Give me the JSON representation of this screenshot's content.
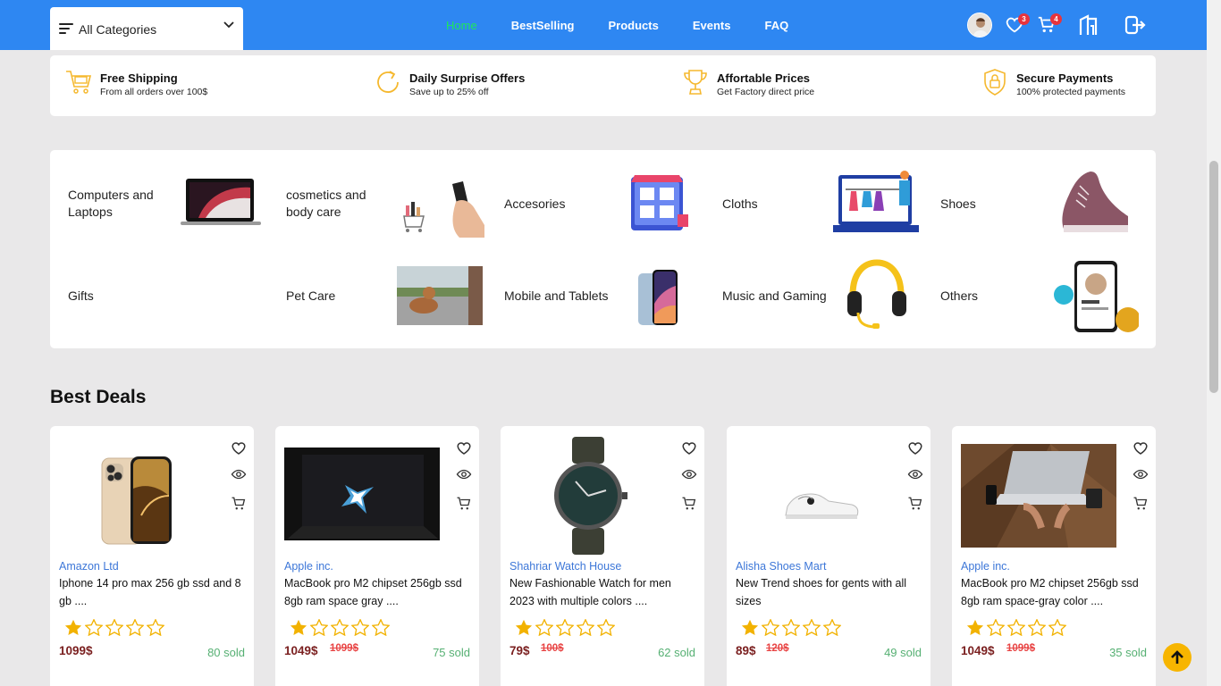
{
  "header": {
    "categories_label": "All Categories",
    "nav": [
      {
        "label": "Home",
        "active": true
      },
      {
        "label": "BestSelling",
        "active": false
      },
      {
        "label": "Products",
        "active": false
      },
      {
        "label": "Events",
        "active": false
      },
      {
        "label": "FAQ",
        "active": false
      }
    ],
    "wishlist_count": "3",
    "cart_count": "4",
    "icons": [
      "avatar",
      "heart-icon",
      "cart-icon",
      "seller-shop-icon",
      "logout-icon"
    ]
  },
  "features": [
    {
      "title": "Free Shipping",
      "subtitle": "From all orders over 100$",
      "icon": "cart-icon"
    },
    {
      "title": "Daily Surprise Offers",
      "subtitle": "Save up to 25% off",
      "icon": "refresh-icon"
    },
    {
      "title": "Affortable Prices",
      "subtitle": "Get Factory direct price",
      "icon": "trophy-icon"
    },
    {
      "title": "Secure Payments",
      "subtitle": "100% protected payments",
      "icon": "shield-lock-icon"
    }
  ],
  "categories": [
    {
      "name": "Computers and Laptops"
    },
    {
      "name": "cosmetics and body care"
    },
    {
      "name": "Accesories"
    },
    {
      "name": "Cloths"
    },
    {
      "name": "Shoes"
    },
    {
      "name": "Gifts"
    },
    {
      "name": "Pet Care"
    },
    {
      "name": "Mobile and Tablets"
    },
    {
      "name": "Music and Gaming"
    },
    {
      "name": "Others"
    }
  ],
  "best_deals": {
    "title": "Best Deals",
    "products": [
      {
        "shop": "Amazon Ltd",
        "name": "Iphone 14 pro max 256 gb ssd and 8 gb ....",
        "rating": 1,
        "price": "1099$",
        "old_price": "",
        "sold": "80 sold"
      },
      {
        "shop": "Apple inc.",
        "name": "MacBook pro M2 chipset 256gb ssd 8gb ram space gray ....",
        "rating": 1,
        "price": "1049$",
        "old_price": "1099$",
        "sold": "75 sold"
      },
      {
        "shop": "Shahriar Watch House",
        "name": "New Fashionable Watch for men 2023 with multiple colors ....",
        "rating": 1,
        "price": "79$",
        "old_price": "100$",
        "sold": "62 sold"
      },
      {
        "shop": "Alisha Shoes Mart",
        "name": "New Trend shoes for gents with all sizes",
        "rating": 1,
        "price": "89$",
        "old_price": "120$",
        "sold": "49 sold"
      },
      {
        "shop": "Apple inc.",
        "name": "MacBook pro M2 chipset 256gb ssd 8gb ram space-gray color ....",
        "rating": 1,
        "price": "1049$",
        "old_price": "1099$",
        "sold": "35 sold"
      }
    ]
  },
  "colors": {
    "header": "#2e87f2",
    "active_nav": "#1ee85a",
    "accent": "#f7b500",
    "shop_link": "#3d77d8",
    "sold": "#56b073"
  }
}
